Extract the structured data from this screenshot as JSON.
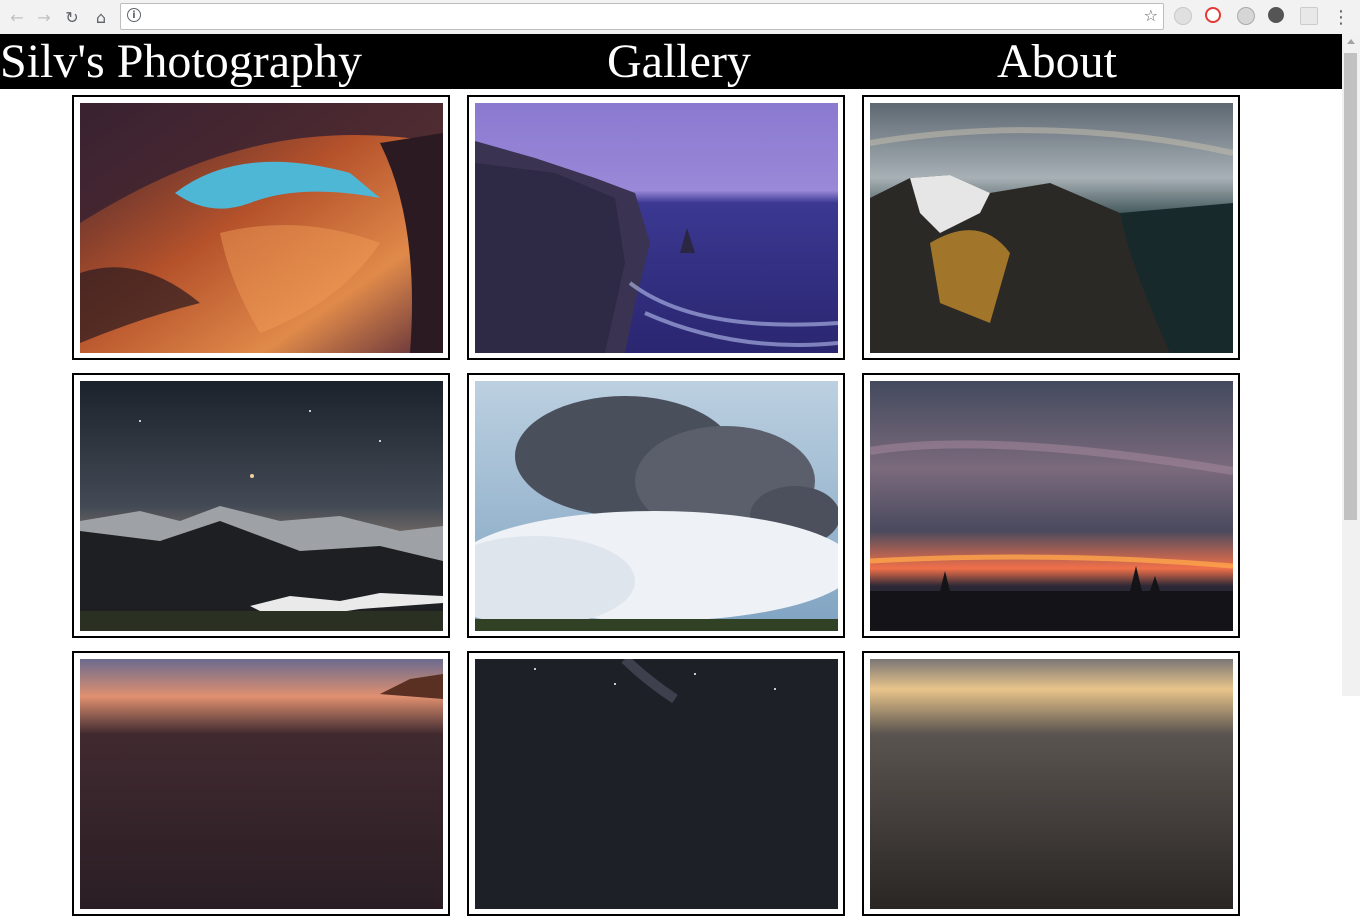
{
  "browser": {
    "address_value": "",
    "back_icon": "back-arrow-icon",
    "forward_icon": "forward-arrow-icon",
    "reload_icon": "reload-icon",
    "home_icon": "home-icon",
    "info_icon": "info-icon",
    "bookmark_icon": "star-icon",
    "menu_icon": "kebab-menu-icon"
  },
  "site": {
    "brand": "Silv's Photography",
    "nav": [
      "Gallery",
      "About"
    ]
  },
  "gallery": {
    "photos": [
      {
        "subject": "slot canyon"
      },
      {
        "subject": "sea cliffs at dusk"
      },
      {
        "subject": "mountain ridge over lake"
      },
      {
        "subject": "starry sky over mountains"
      },
      {
        "subject": "volcanic ash cloud"
      },
      {
        "subject": "sunset over forest"
      },
      {
        "subject": "sunset landscape"
      },
      {
        "subject": "night sky"
      },
      {
        "subject": "golden clouds"
      }
    ]
  }
}
